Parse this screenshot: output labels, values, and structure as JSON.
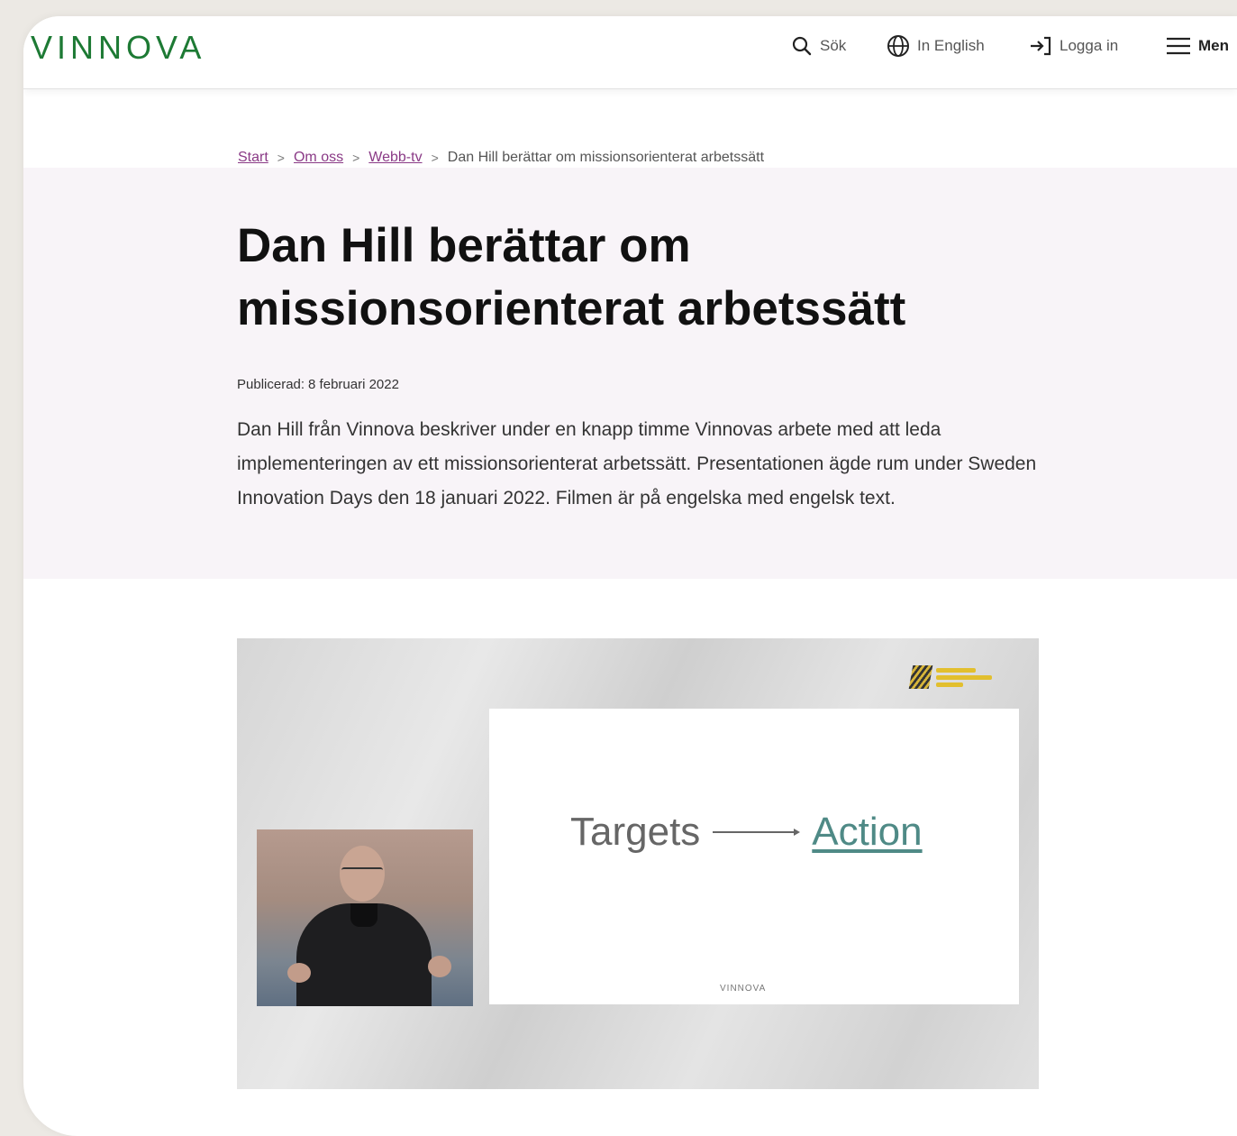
{
  "brand": {
    "logo_text": "VINNOVA",
    "accent": "#1d7a34",
    "link_color": "#8a3a86"
  },
  "header": {
    "search_label": "Sök",
    "language_label": "In English",
    "login_label": "Logga in",
    "menu_label": "Men"
  },
  "breadcrumb": {
    "items": [
      "Start",
      "Om oss",
      "Webb-tv"
    ],
    "current": "Dan Hill berättar om missionsorienterat arbetssätt"
  },
  "article": {
    "title": "Dan Hill berättar om missionsorienterat arbetssätt",
    "published_label": "Publicerad:",
    "published_date": "8 februari 2022",
    "description": "Dan Hill från Vinnova beskriver under en knapp timme Vinnovas arbete med att leda implementeringen av ett missionsorienterat arbetssätt. Presentationen ägde rum under Sweden Innovation Days den 18 januari 2022. Filmen är på engelska med engelsk text."
  },
  "video": {
    "slide_left_text": "Targets",
    "slide_right_text": "Action",
    "slide_logo": "VINNOVA",
    "action_color": "#4f8a86"
  }
}
